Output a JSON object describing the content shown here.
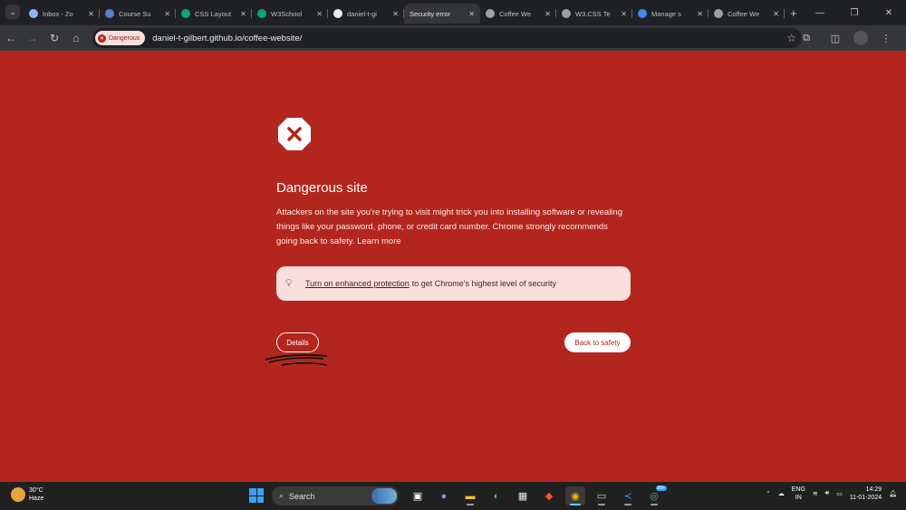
{
  "browser": {
    "tabs": [
      {
        "title": "Inbox - Zo",
        "favicon": "inbox-icon",
        "color": "#8ab4f8",
        "active": false
      },
      {
        "title": "Course Su",
        "favicon": "course-icon",
        "color": "#5a7bd6",
        "active": false
      },
      {
        "title": "CSS Layout",
        "favicon": "w3schools-icon",
        "color": "#04aa6d",
        "active": false
      },
      {
        "title": "W3School",
        "favicon": "w3schools-icon",
        "color": "#04aa6d",
        "active": false
      },
      {
        "title": "daniel-t-gi",
        "favicon": "github-icon",
        "color": "#e8eaed",
        "active": false
      },
      {
        "title": "Security error",
        "favicon": "",
        "color": "#35363a",
        "active": true
      },
      {
        "title": "Coffee We",
        "favicon": "globe-icon",
        "color": "#9aa0a6",
        "active": false
      },
      {
        "title": "W3.CSS Te",
        "favicon": "globe-icon",
        "color": "#9aa0a6",
        "active": false
      },
      {
        "title": "Manage s",
        "favicon": "google-icon",
        "color": "#4285f4",
        "active": false
      },
      {
        "title": "Coffee We",
        "favicon": "globe-icon",
        "color": "#9aa0a6",
        "active": false
      }
    ],
    "security_chip": "Dangerous",
    "url": "daniel-t-gilbert.github.io/coffee-website/"
  },
  "interstitial": {
    "heading": "Dangerous site",
    "body": "Attackers on the site you're trying to visit might trick you into installing software or revealing things like your password, phone, or credit card number. Chrome strongly recommends going back to safety.",
    "learn_more": "Learn more",
    "promo_link": "Turn on enhanced protection",
    "promo_text": "to get Chrome's highest level of security",
    "details_label": "Details",
    "back_label": "Back to safety"
  },
  "taskbar": {
    "weather_temp": "30°C",
    "weather_desc": "Haze",
    "search_label": "Search",
    "whatsapp_badge": "99+",
    "lang_top": "ENG",
    "lang_bottom": "IN",
    "time": "14:29",
    "date": "11-01-2024"
  },
  "colors": {
    "page_bg": "#b3261e",
    "promo_bg": "#f9dedc",
    "accent": "#60cdff"
  }
}
